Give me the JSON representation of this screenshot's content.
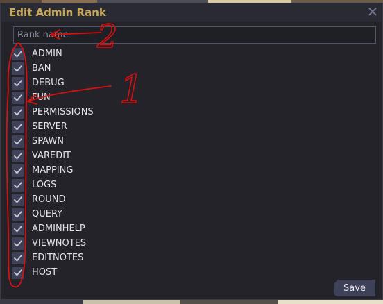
{
  "window": {
    "title": "Edit Admin Rank",
    "close_glyph": "✕"
  },
  "rank_input": {
    "value": "",
    "placeholder": "Rank name"
  },
  "permissions": [
    {
      "label": "ADMIN",
      "checked": true
    },
    {
      "label": "BAN",
      "checked": true
    },
    {
      "label": "DEBUG",
      "checked": true
    },
    {
      "label": "FUN",
      "checked": true
    },
    {
      "label": "PERMISSIONS",
      "checked": true
    },
    {
      "label": "SERVER",
      "checked": true
    },
    {
      "label": "SPAWN",
      "checked": true
    },
    {
      "label": "VAREDIT",
      "checked": true
    },
    {
      "label": "MAPPING",
      "checked": true
    },
    {
      "label": "LOGS",
      "checked": true
    },
    {
      "label": "ROUND",
      "checked": true
    },
    {
      "label": "QUERY",
      "checked": true
    },
    {
      "label": "ADMINHELP",
      "checked": true
    },
    {
      "label": "VIEWNOTES",
      "checked": true
    },
    {
      "label": "EDITNOTES",
      "checked": true
    },
    {
      "label": "HOST",
      "checked": true
    }
  ],
  "save_button": {
    "label": "Save"
  },
  "annotations": {
    "number_1": "1",
    "number_2": "2",
    "color": "#d81010"
  },
  "colors": {
    "title": "#c9a85a",
    "window_bg": "#232329",
    "checkbox_bg": "#3e4158",
    "checkmark": "#c8cad8"
  }
}
